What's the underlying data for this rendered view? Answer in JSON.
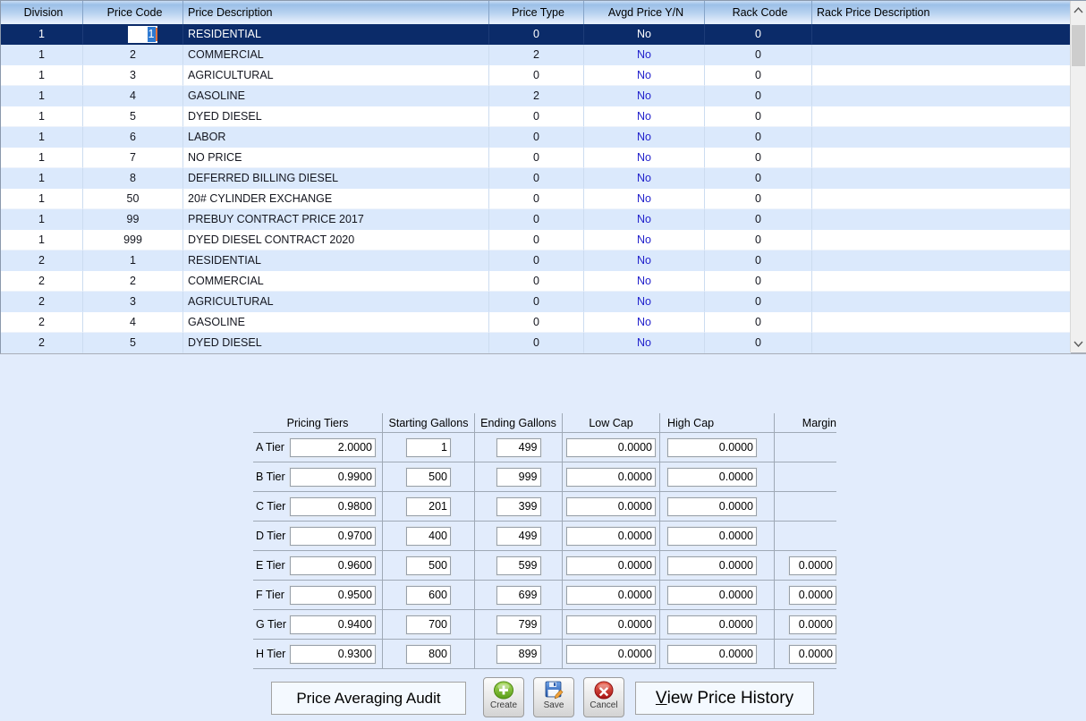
{
  "grid": {
    "columns": [
      {
        "label": "Division"
      },
      {
        "label": "Price Code"
      },
      {
        "label": "Price Description"
      },
      {
        "label": "Price Type"
      },
      {
        "label": "Avgd Price Y/N"
      },
      {
        "label": "Rack Code"
      },
      {
        "label": "Rack Price Description"
      }
    ],
    "rows": [
      {
        "division": "1",
        "price_code": "1",
        "description": "RESIDENTIAL",
        "price_type": "0",
        "avgd_price": "No",
        "rack_code": "0",
        "rack_description": "",
        "selected": true,
        "editing": true
      },
      {
        "division": "1",
        "price_code": "2",
        "description": "COMMERCIAL",
        "price_type": "2",
        "avgd_price": "No",
        "rack_code": "0",
        "rack_description": ""
      },
      {
        "division": "1",
        "price_code": "3",
        "description": "AGRICULTURAL",
        "price_type": "0",
        "avgd_price": "No",
        "rack_code": "0",
        "rack_description": ""
      },
      {
        "division": "1",
        "price_code": "4",
        "description": "GASOLINE",
        "price_type": "2",
        "avgd_price": "No",
        "rack_code": "0",
        "rack_description": ""
      },
      {
        "division": "1",
        "price_code": "5",
        "description": "DYED DIESEL",
        "price_type": "0",
        "avgd_price": "No",
        "rack_code": "0",
        "rack_description": ""
      },
      {
        "division": "1",
        "price_code": "6",
        "description": "LABOR",
        "price_type": "0",
        "avgd_price": "No",
        "rack_code": "0",
        "rack_description": ""
      },
      {
        "division": "1",
        "price_code": "7",
        "description": "NO PRICE",
        "price_type": "0",
        "avgd_price": "No",
        "rack_code": "0",
        "rack_description": ""
      },
      {
        "division": "1",
        "price_code": "8",
        "description": "DEFERRED BILLING DIESEL",
        "price_type": "0",
        "avgd_price": "No",
        "rack_code": "0",
        "rack_description": ""
      },
      {
        "division": "1",
        "price_code": "50",
        "description": "20# CYLINDER EXCHANGE",
        "price_type": "0",
        "avgd_price": "No",
        "rack_code": "0",
        "rack_description": ""
      },
      {
        "division": "1",
        "price_code": "99",
        "description": "PREBUY CONTRACT PRICE 2017",
        "price_type": "0",
        "avgd_price": "No",
        "rack_code": "0",
        "rack_description": ""
      },
      {
        "division": "1",
        "price_code": "999",
        "description": "DYED DIESEL CONTRACT 2020",
        "price_type": "0",
        "avgd_price": "No",
        "rack_code": "0",
        "rack_description": ""
      },
      {
        "division": "2",
        "price_code": "1",
        "description": "RESIDENTIAL",
        "price_type": "0",
        "avgd_price": "No",
        "rack_code": "0",
        "rack_description": ""
      },
      {
        "division": "2",
        "price_code": "2",
        "description": "COMMERCIAL",
        "price_type": "0",
        "avgd_price": "No",
        "rack_code": "0",
        "rack_description": ""
      },
      {
        "division": "2",
        "price_code": "3",
        "description": "AGRICULTURAL",
        "price_type": "0",
        "avgd_price": "No",
        "rack_code": "0",
        "rack_description": ""
      },
      {
        "division": "2",
        "price_code": "4",
        "description": "GASOLINE",
        "price_type": "0",
        "avgd_price": "No",
        "rack_code": "0",
        "rack_description": ""
      },
      {
        "division": "2",
        "price_code": "5",
        "description": "DYED DIESEL",
        "price_type": "0",
        "avgd_price": "No",
        "rack_code": "0",
        "rack_description": ""
      }
    ]
  },
  "tiers": {
    "headers": [
      "Pricing Tiers",
      "Starting Gallons",
      "Ending Gallons",
      "Low Cap",
      "High Cap",
      "Margin"
    ],
    "rows": [
      {
        "label": "A Tier",
        "price": "2.0000",
        "starting_gallons": "1",
        "ending_gallons": "499",
        "low_cap": "0.0000",
        "high_cap": "0.0000",
        "margin": null
      },
      {
        "label": "B Tier",
        "price": "0.9900",
        "starting_gallons": "500",
        "ending_gallons": "999",
        "low_cap": "0.0000",
        "high_cap": "0.0000",
        "margin": null
      },
      {
        "label": "C Tier",
        "price": "0.9800",
        "starting_gallons": "201",
        "ending_gallons": "399",
        "low_cap": "0.0000",
        "high_cap": "0.0000",
        "margin": null
      },
      {
        "label": "D Tier",
        "price": "0.9700",
        "starting_gallons": "400",
        "ending_gallons": "499",
        "low_cap": "0.0000",
        "high_cap": "0.0000",
        "margin": null
      },
      {
        "label": "E Tier",
        "price": "0.9600",
        "starting_gallons": "500",
        "ending_gallons": "599",
        "low_cap": "0.0000",
        "high_cap": "0.0000",
        "margin": "0.0000"
      },
      {
        "label": "F Tier",
        "price": "0.9500",
        "starting_gallons": "600",
        "ending_gallons": "699",
        "low_cap": "0.0000",
        "high_cap": "0.0000",
        "margin": "0.0000"
      },
      {
        "label": "G Tier",
        "price": "0.9400",
        "starting_gallons": "700",
        "ending_gallons": "799",
        "low_cap": "0.0000",
        "high_cap": "0.0000",
        "margin": "0.0000"
      },
      {
        "label": "H Tier",
        "price": "0.9300",
        "starting_gallons": "800",
        "ending_gallons": "899",
        "low_cap": "0.0000",
        "high_cap": "0.0000",
        "margin": "0.0000"
      }
    ]
  },
  "buttons": {
    "price_averaging_audit": "Price Averaging Audit",
    "create": "Create",
    "save": "Save",
    "cancel": "Cancel",
    "view_price_history_prefix": "V",
    "view_price_history_suffix": "iew Price History"
  },
  "icons": {
    "create": "plus-circle",
    "save": "floppy-disk-pencil",
    "cancel": "x-circle",
    "scrollbar_up": "chevron-up",
    "scrollbar_down": "chevron-down"
  },
  "colors": {
    "page_background": "#e2ecfc",
    "selected_row": "#0b2b69",
    "alt_row": "#dbe9fc",
    "avgd_link_blue": "#2222cc",
    "edit_selection": "#2e7ad2",
    "edit_caret": "#e2703a",
    "create_green": "#6cb21e",
    "cancel_red": "#cc1f1f",
    "save_blue": "#2f6fd0"
  }
}
